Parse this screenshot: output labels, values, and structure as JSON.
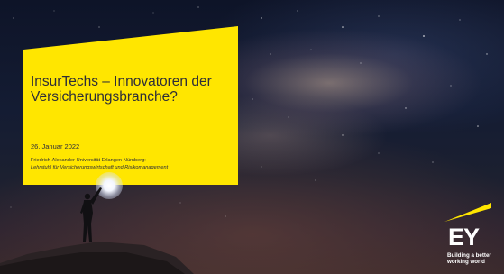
{
  "slide": {
    "title": "InsurTechs – Innovatoren der Versicherungsbranche?",
    "date": "26. Januar 2022",
    "university": "Friedrich-Alexander-Universität Erlangen-Nürnberg:",
    "chair": "Lehrstuhl für Versicherungswirtschaft und Risikomanagement"
  },
  "brand": {
    "logo_text": "EY",
    "tagline_line1": "Building a better",
    "tagline_line2": "working world",
    "accent_color": "#ffe600"
  },
  "colors": {
    "text_dark": "#2e2e38",
    "sky_top": "#0e1428"
  }
}
